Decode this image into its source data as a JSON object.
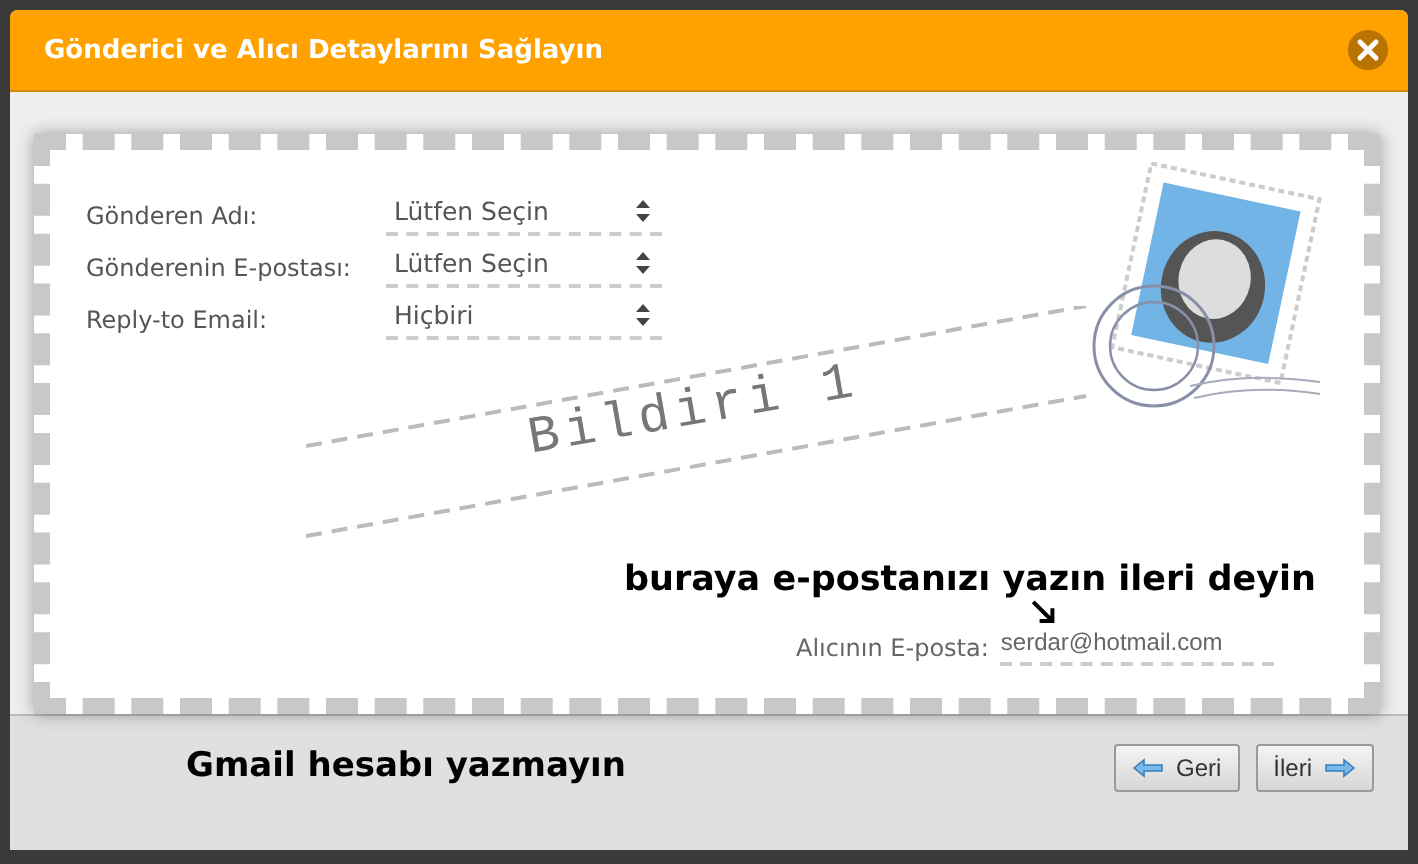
{
  "dialog": {
    "title": "Gönderici ve Alıcı Detaylarını Sağlayın"
  },
  "fields": [
    {
      "label": "Gönderen Adı:",
      "value": "Lütfen Seçin"
    },
    {
      "label": "Gönderenin E-postası:",
      "value": "Lütfen Seçin"
    },
    {
      "label": "Reply-to Email:",
      "value": "Hiçbiri"
    }
  ],
  "notice_title": "Bildiri 1",
  "recipient": {
    "label": "Alıcının E-posta:",
    "value": "serdar@hotmail.com"
  },
  "annotations": [
    "buraya e-postanızı yazın ileri deyin",
    "Gmail hesabı yazmayın"
  ],
  "buttons": [
    {
      "label": "Geri",
      "kind": "back"
    },
    {
      "label": "İleri",
      "kind": "next"
    }
  ]
}
